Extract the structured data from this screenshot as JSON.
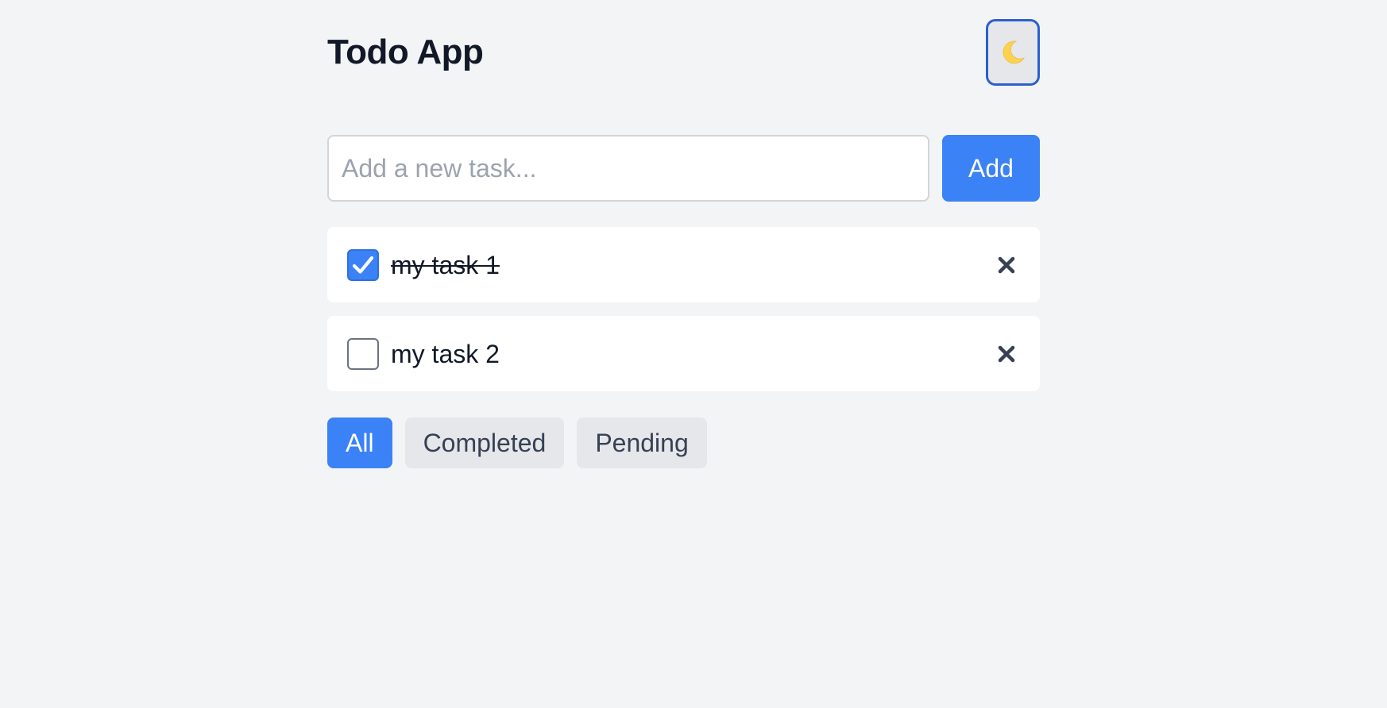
{
  "header": {
    "title": "Todo App",
    "theme_toggle_icon": "moon-icon"
  },
  "add_task": {
    "placeholder": "Add a new task...",
    "value": "",
    "add_label": "Add"
  },
  "tasks": [
    {
      "text": "my task 1",
      "completed": true,
      "delete_icon": "close-icon"
    },
    {
      "text": "my task 2",
      "completed": false,
      "delete_icon": "close-icon"
    }
  ],
  "filters": {
    "items": [
      {
        "label": "All",
        "active": true
      },
      {
        "label": "Completed",
        "active": false
      },
      {
        "label": "Pending",
        "active": false
      }
    ]
  },
  "colors": {
    "background": "#f3f4f6",
    "accent": "#3b82f6",
    "toggle_border": "#2b5fd0",
    "moon": "#fcd34d",
    "text": "#111827",
    "delete_icon": "#374151"
  }
}
